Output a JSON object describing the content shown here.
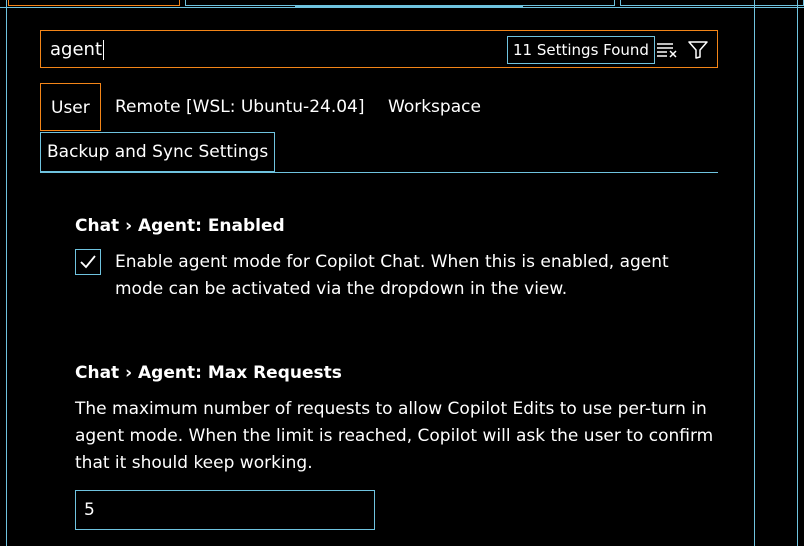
{
  "search": {
    "value": "agent",
    "results_count": "11 Settings Found",
    "clear_icon": "clear-filter-icon",
    "filter_icon": "filter-icon"
  },
  "scopes": {
    "user": "User",
    "remote": "Remote [WSL: Ubuntu-24.04]",
    "workspace": "Workspace",
    "sync": "Backup and Sync Settings"
  },
  "settings": [
    {
      "title": "Chat › Agent: Enabled",
      "description": "Enable agent mode for Copilot Chat. When this is enabled, agent mode can be activated via the dropdown in the view.",
      "checked": true
    },
    {
      "title": "Chat › Agent: Max Requests",
      "description": "The maximum number of requests to allow Copilot Edits to use per-turn in agent mode. When the limit is reached, Copilot will ask the user to confirm that it should keep working.",
      "value": "5"
    }
  ],
  "colors": {
    "background": "#000000",
    "focus_border": "#f38518",
    "contrast_border": "#6fc3df",
    "text": "#ffffff"
  }
}
